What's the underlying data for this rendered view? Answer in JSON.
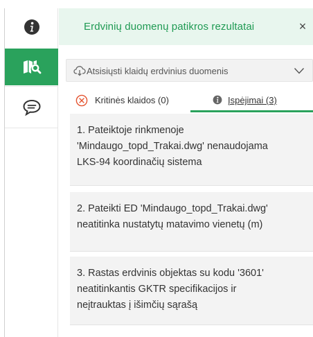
{
  "sidebar": {
    "items": [
      {
        "icon": "info-icon",
        "active": false
      },
      {
        "icon": "map-search-icon",
        "active": true
      },
      {
        "icon": "comment-icon",
        "active": false
      }
    ],
    "accent_color": "#2aa25c"
  },
  "panel": {
    "title": "Erdvinių duomenų patikros rezultatai",
    "close_label": "×",
    "title_color": "#1f9a53",
    "header_bg": "#e8f6ee"
  },
  "download": {
    "label": "Atsisiųsti klaidų erdvinius duomenis",
    "icon": "cloud-download-icon",
    "dropdown_icon": "chevron-down-icon"
  },
  "tabs": [
    {
      "label": "Kritinės klaidos (0)",
      "icon": "error-circle-icon",
      "active": false
    },
    {
      "label": "Įspėjimai (3)",
      "icon": "warning-info-icon",
      "active": true
    }
  ],
  "issues": [
    {
      "text": "1. Pateiktoje rinkmenoje\n'Mindaugo_topd_Trakai.dwg' nenaudojama\nLKS-94 koordinačių sistema"
    },
    {
      "text": "2. Pateikti ED 'Mindaugo_topd_Trakai.dwg'\nneatitinka nustatytų matavimo vienetų (m)"
    },
    {
      "text": "3. Rastas erdvinis objektas su kodu '3601'\nneatitinkantis GKTR specifikacijos ir\nneįtrauktas į išimčių sąrašą"
    }
  ]
}
